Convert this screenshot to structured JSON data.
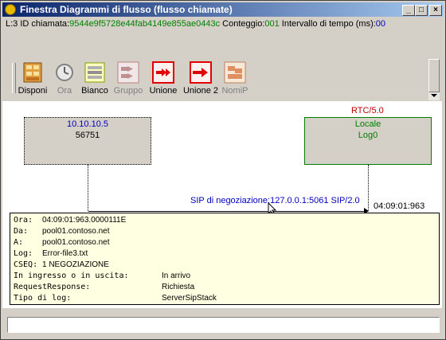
{
  "window": {
    "title": "Finestra Diagrammi di flusso (flusso chiamate)"
  },
  "infobar": {
    "prefix": "L:3 ID chiamata:",
    "call_id": "9544e9f5728e44fab4149e855ae0443c",
    "count_label": " Conteggio:",
    "count": "001",
    "interval_label": " Intervallo di tempo (ms):",
    "interval": "00"
  },
  "toolbar": {
    "items": [
      {
        "label": "Disponi",
        "icon": "arrange-icon"
      },
      {
        "label": "Ora",
        "icon": "clock-icon"
      },
      {
        "label": "Bianco",
        "icon": "white-icon"
      },
      {
        "label": "Gruppo",
        "icon": "group-icon"
      },
      {
        "label": "Unione",
        "icon": "merge-icon"
      },
      {
        "label": "Unione 2",
        "icon": "merge2-icon"
      },
      {
        "label": "NomiP",
        "icon": "names-icon"
      }
    ]
  },
  "diagram": {
    "rtc_label": "RTC/5.0",
    "left_node": {
      "ip": "10.10.10.5",
      "port": "56751"
    },
    "right_node": {
      "name": "Locale",
      "log": "Log0"
    },
    "message": "SIP di negoziazione:127.0.0.1:5061 SIP/2.0",
    "time": "04:09:01:963"
  },
  "details": {
    "ora_label": "Ora:",
    "ora": "04:09:01:963.0000111E",
    "da_label": "Da:",
    "da": "pool01.contoso.net",
    "a_label": "A:",
    "a": "pool01.contoso.net",
    "log_label": "Log:",
    "log": "Error-file3.txt",
    "cseq_label": "CSEQ:",
    "cseq": "1 NEGOZIAZIONE",
    "direction_label": "In ingresso o in uscita:",
    "direction": "In arrivo",
    "reqresp_label": "RequestResponse:",
    "reqresp": "Richiesta",
    "logtype_label": "Tipo di log:",
    "logtype": "ServerSipStack"
  },
  "colors": {
    "title_start": "#0a246a",
    "title_end": "#a6caf0",
    "id_green": "#008000",
    "ip_blue": "#0000c0",
    "rtc_red": "#c00000",
    "detail_bg": "#ffffe1"
  }
}
